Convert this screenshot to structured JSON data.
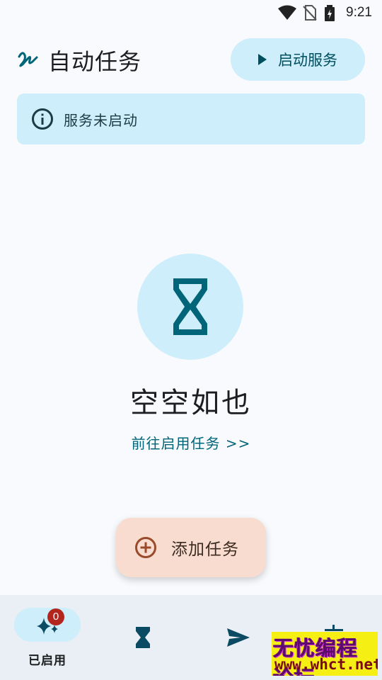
{
  "status_bar": {
    "time": "9:21"
  },
  "header": {
    "title": "自动任务",
    "start_button_label": "启动服务"
  },
  "banner": {
    "text": "服务未启动"
  },
  "empty_state": {
    "title": "空空如也",
    "link_text": "前往启用任务 >>"
  },
  "fab": {
    "label": "添加任务"
  },
  "bottom_nav": {
    "items": [
      {
        "label": "已启用",
        "icon": "sparkles-icon",
        "badge": "0",
        "active": true
      },
      {
        "label": "",
        "icon": "hourglass-icon"
      },
      {
        "label": "",
        "icon": "send-icon"
      },
      {
        "label": "",
        "icon": "more-icon"
      }
    ]
  },
  "watermark": {
    "line1": "无忧编程论坛",
    "line2": "www.whct.net"
  },
  "colors": {
    "accent": "#006578",
    "container": "#cdeefa",
    "fab": "#f8dccf",
    "badge": "#b3261e",
    "background": "#f8fafd"
  }
}
